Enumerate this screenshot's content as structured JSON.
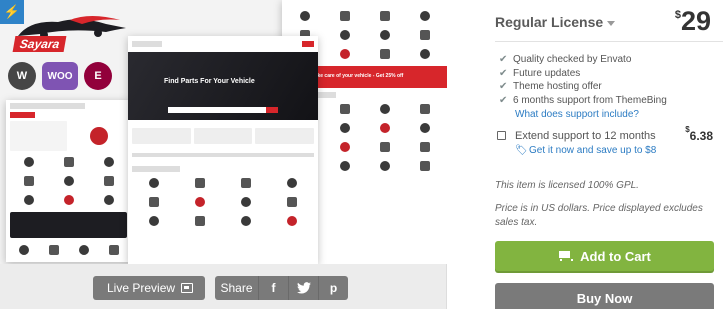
{
  "preview": {
    "brand_name": "Sayara",
    "hero_title": "Find Parts For Your Vehicle",
    "promo_text": "Take care of your vehicle - Get 25% off",
    "platforms": [
      "W",
      "WOO",
      "E"
    ]
  },
  "actions": {
    "live_preview_label": "Live Preview",
    "share_label": "Share",
    "facebook_glyph": "f",
    "twitter_glyph": "t",
    "pinterest_glyph": "p"
  },
  "purchase": {
    "license_label": "Regular License",
    "currency": "$",
    "price": "29",
    "features": [
      "Quality checked by Envato",
      "Future updates",
      "Theme hosting offer",
      "6 months support from ThemeBing"
    ],
    "support_link": "What does support include?",
    "extend_label": "Extend support to 12 months",
    "extend_currency": "$",
    "extend_price": "6.38",
    "save_link": "Get it now and save up to $8",
    "gpl_note": "This item is licensed 100% GPL.",
    "price_note": "Price is in US dollars. Price displayed excludes sales tax.",
    "add_to_cart_label": "Add to Cart",
    "buy_now_label": "Buy Now"
  },
  "colors": {
    "accent_green": "#82b440",
    "link_blue": "#2c7cc3",
    "brand_red": "#d7262b",
    "button_grey": "#7a7a7a"
  }
}
